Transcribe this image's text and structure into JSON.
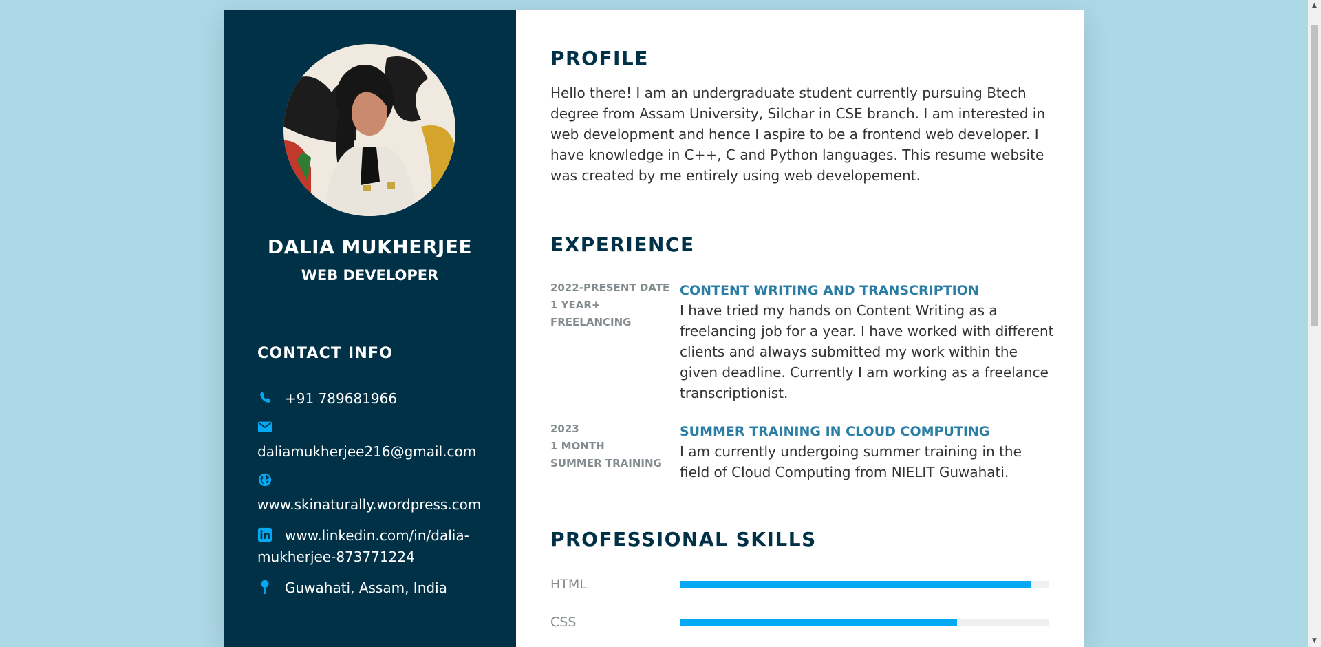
{
  "colors": {
    "page_bg": "#add8e6",
    "sidebar_bg": "#003147",
    "accent": "#03a9f4",
    "heading": "#003147",
    "job_title": "#2a7ea5"
  },
  "sidebar": {
    "name": "DALIA MUKHERJEE",
    "role": "WEB DEVELOPER",
    "contact_title": "CONTACT INFO",
    "contacts": [
      {
        "icon": "phone-icon",
        "text": "+91 789681966"
      },
      {
        "icon": "envelope-icon",
        "text": "daliamukherjee216@gmail.com"
      },
      {
        "icon": "globe-icon",
        "text": "www.skinaturally.wordpress.com"
      },
      {
        "icon": "linkedin-icon",
        "text": "www.linkedin.com/in/dalia-mukherjee-873771224"
      },
      {
        "icon": "map-pin-icon",
        "text": "Guwahati, Assam, India"
      }
    ]
  },
  "main": {
    "profile": {
      "title": "PROFILE",
      "text": "Hello there! I am an undergraduate student currently pursuing Btech degree from Assam University, Silchar in CSE branch. I am interested in web development and hence I aspire to be a frontend web developer. I have knowledge in C++, C and Python languages. This resume website was created by me entirely using web developement."
    },
    "experience": {
      "title": "EXPERIENCE",
      "items": [
        {
          "date": "2022-PRESENT DATE",
          "duration": "1 YEAR+",
          "type": "FREELANCING",
          "title": "CONTENT WRITING AND TRANSCRIPTION",
          "desc": "I have tried my hands on Content Writing as a freelancing job for a year. I have worked with different clients and always submitted my work within the given deadline. Currently I am working as a freelance transcriptionist."
        },
        {
          "date": "2023",
          "duration": "1 MONTH",
          "type": "SUMMER TRAINING",
          "title": "SUMMER TRAINING IN CLOUD COMPUTING",
          "desc": "I am currently undergoing summer training in the field of Cloud Computing from NIELIT Guwahati."
        }
      ]
    },
    "skills": {
      "title": "PROFESSIONAL SKILLS",
      "items": [
        {
          "name": "HTML",
          "level": 0.95
        },
        {
          "name": "CSS",
          "level": 0.75
        }
      ]
    }
  }
}
